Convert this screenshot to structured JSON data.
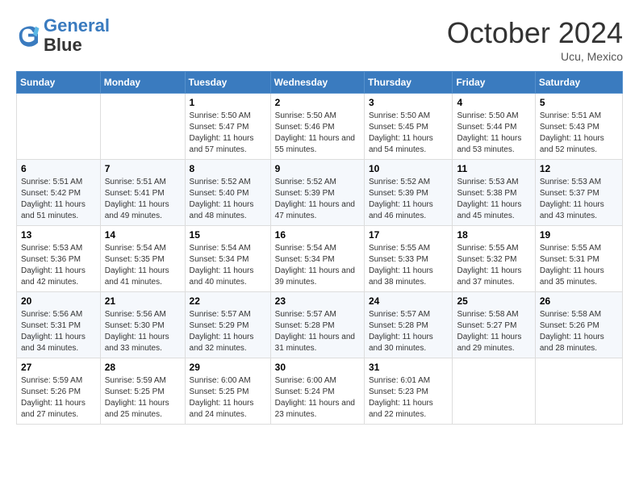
{
  "header": {
    "logo_line1": "General",
    "logo_line2": "Blue",
    "month": "October 2024",
    "location": "Ucu, Mexico"
  },
  "weekdays": [
    "Sunday",
    "Monday",
    "Tuesday",
    "Wednesday",
    "Thursday",
    "Friday",
    "Saturday"
  ],
  "weeks": [
    [
      {
        "day": "",
        "sunrise": "",
        "sunset": "",
        "daylight": ""
      },
      {
        "day": "",
        "sunrise": "",
        "sunset": "",
        "daylight": ""
      },
      {
        "day": "1",
        "sunrise": "Sunrise: 5:50 AM",
        "sunset": "Sunset: 5:47 PM",
        "daylight": "Daylight: 11 hours and 57 minutes."
      },
      {
        "day": "2",
        "sunrise": "Sunrise: 5:50 AM",
        "sunset": "Sunset: 5:46 PM",
        "daylight": "Daylight: 11 hours and 55 minutes."
      },
      {
        "day": "3",
        "sunrise": "Sunrise: 5:50 AM",
        "sunset": "Sunset: 5:45 PM",
        "daylight": "Daylight: 11 hours and 54 minutes."
      },
      {
        "day": "4",
        "sunrise": "Sunrise: 5:50 AM",
        "sunset": "Sunset: 5:44 PM",
        "daylight": "Daylight: 11 hours and 53 minutes."
      },
      {
        "day": "5",
        "sunrise": "Sunrise: 5:51 AM",
        "sunset": "Sunset: 5:43 PM",
        "daylight": "Daylight: 11 hours and 52 minutes."
      }
    ],
    [
      {
        "day": "6",
        "sunrise": "Sunrise: 5:51 AM",
        "sunset": "Sunset: 5:42 PM",
        "daylight": "Daylight: 11 hours and 51 minutes."
      },
      {
        "day": "7",
        "sunrise": "Sunrise: 5:51 AM",
        "sunset": "Sunset: 5:41 PM",
        "daylight": "Daylight: 11 hours and 49 minutes."
      },
      {
        "day": "8",
        "sunrise": "Sunrise: 5:52 AM",
        "sunset": "Sunset: 5:40 PM",
        "daylight": "Daylight: 11 hours and 48 minutes."
      },
      {
        "day": "9",
        "sunrise": "Sunrise: 5:52 AM",
        "sunset": "Sunset: 5:39 PM",
        "daylight": "Daylight: 11 hours and 47 minutes."
      },
      {
        "day": "10",
        "sunrise": "Sunrise: 5:52 AM",
        "sunset": "Sunset: 5:39 PM",
        "daylight": "Daylight: 11 hours and 46 minutes."
      },
      {
        "day": "11",
        "sunrise": "Sunrise: 5:53 AM",
        "sunset": "Sunset: 5:38 PM",
        "daylight": "Daylight: 11 hours and 45 minutes."
      },
      {
        "day": "12",
        "sunrise": "Sunrise: 5:53 AM",
        "sunset": "Sunset: 5:37 PM",
        "daylight": "Daylight: 11 hours and 43 minutes."
      }
    ],
    [
      {
        "day": "13",
        "sunrise": "Sunrise: 5:53 AM",
        "sunset": "Sunset: 5:36 PM",
        "daylight": "Daylight: 11 hours and 42 minutes."
      },
      {
        "day": "14",
        "sunrise": "Sunrise: 5:54 AM",
        "sunset": "Sunset: 5:35 PM",
        "daylight": "Daylight: 11 hours and 41 minutes."
      },
      {
        "day": "15",
        "sunrise": "Sunrise: 5:54 AM",
        "sunset": "Sunset: 5:34 PM",
        "daylight": "Daylight: 11 hours and 40 minutes."
      },
      {
        "day": "16",
        "sunrise": "Sunrise: 5:54 AM",
        "sunset": "Sunset: 5:34 PM",
        "daylight": "Daylight: 11 hours and 39 minutes."
      },
      {
        "day": "17",
        "sunrise": "Sunrise: 5:55 AM",
        "sunset": "Sunset: 5:33 PM",
        "daylight": "Daylight: 11 hours and 38 minutes."
      },
      {
        "day": "18",
        "sunrise": "Sunrise: 5:55 AM",
        "sunset": "Sunset: 5:32 PM",
        "daylight": "Daylight: 11 hours and 37 minutes."
      },
      {
        "day": "19",
        "sunrise": "Sunrise: 5:55 AM",
        "sunset": "Sunset: 5:31 PM",
        "daylight": "Daylight: 11 hours and 35 minutes."
      }
    ],
    [
      {
        "day": "20",
        "sunrise": "Sunrise: 5:56 AM",
        "sunset": "Sunset: 5:31 PM",
        "daylight": "Daylight: 11 hours and 34 minutes."
      },
      {
        "day": "21",
        "sunrise": "Sunrise: 5:56 AM",
        "sunset": "Sunset: 5:30 PM",
        "daylight": "Daylight: 11 hours and 33 minutes."
      },
      {
        "day": "22",
        "sunrise": "Sunrise: 5:57 AM",
        "sunset": "Sunset: 5:29 PM",
        "daylight": "Daylight: 11 hours and 32 minutes."
      },
      {
        "day": "23",
        "sunrise": "Sunrise: 5:57 AM",
        "sunset": "Sunset: 5:28 PM",
        "daylight": "Daylight: 11 hours and 31 minutes."
      },
      {
        "day": "24",
        "sunrise": "Sunrise: 5:57 AM",
        "sunset": "Sunset: 5:28 PM",
        "daylight": "Daylight: 11 hours and 30 minutes."
      },
      {
        "day": "25",
        "sunrise": "Sunrise: 5:58 AM",
        "sunset": "Sunset: 5:27 PM",
        "daylight": "Daylight: 11 hours and 29 minutes."
      },
      {
        "day": "26",
        "sunrise": "Sunrise: 5:58 AM",
        "sunset": "Sunset: 5:26 PM",
        "daylight": "Daylight: 11 hours and 28 minutes."
      }
    ],
    [
      {
        "day": "27",
        "sunrise": "Sunrise: 5:59 AM",
        "sunset": "Sunset: 5:26 PM",
        "daylight": "Daylight: 11 hours and 27 minutes."
      },
      {
        "day": "28",
        "sunrise": "Sunrise: 5:59 AM",
        "sunset": "Sunset: 5:25 PM",
        "daylight": "Daylight: 11 hours and 25 minutes."
      },
      {
        "day": "29",
        "sunrise": "Sunrise: 6:00 AM",
        "sunset": "Sunset: 5:25 PM",
        "daylight": "Daylight: 11 hours and 24 minutes."
      },
      {
        "day": "30",
        "sunrise": "Sunrise: 6:00 AM",
        "sunset": "Sunset: 5:24 PM",
        "daylight": "Daylight: 11 hours and 23 minutes."
      },
      {
        "day": "31",
        "sunrise": "Sunrise: 6:01 AM",
        "sunset": "Sunset: 5:23 PM",
        "daylight": "Daylight: 11 hours and 22 minutes."
      },
      {
        "day": "",
        "sunrise": "",
        "sunset": "",
        "daylight": ""
      },
      {
        "day": "",
        "sunrise": "",
        "sunset": "",
        "daylight": ""
      }
    ]
  ]
}
